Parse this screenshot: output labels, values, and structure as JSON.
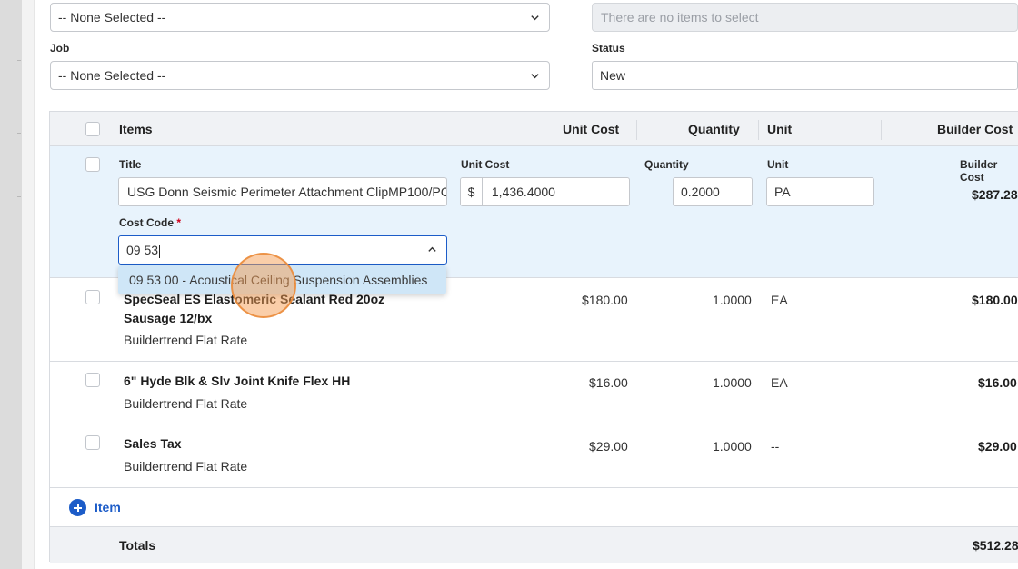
{
  "top_fields": {
    "first_select_value": "-- None Selected --",
    "disabled_field_text": "There are no items to select",
    "job_label": "Job",
    "job_select_value": "-- None Selected --",
    "status_label": "Status",
    "status_value": "New"
  },
  "table": {
    "headers": {
      "items": "Items",
      "unit_cost": "Unit Cost",
      "quantity": "Quantity",
      "unit": "Unit",
      "builder_cost": "Builder Cost"
    },
    "edit_row": {
      "title_label": "Title",
      "title_value": "USG Donn Seismic Perimeter Attachment ClipMP100/PC",
      "unit_cost_label": "Unit Cost",
      "currency_symbol": "$",
      "unit_cost_value": "1,436.4000",
      "quantity_label": "Quantity",
      "quantity_value": "0.2000",
      "unit_label": "Unit",
      "unit_value": "PA",
      "builder_cost_label": "Builder Cost",
      "builder_cost_value": "$287.28",
      "cost_code_label": "Cost Code",
      "required_mark": "*",
      "cost_code_input": "09 53",
      "dropdown_option": "09 53 00 - Acoustical Ceiling Suspension Assemblies"
    },
    "rows": [
      {
        "name": "SpecSeal ES Elastomeric Sealant Red 20oz Sausage 12/bx",
        "subtitle": "Buildertrend Flat Rate",
        "unit_cost": "$180.00",
        "quantity": "1.0000",
        "unit": "EA",
        "builder_cost": "$180.00"
      },
      {
        "name": "6\" Hyde Blk & Slv Joint Knife Flex HH",
        "subtitle": "Buildertrend Flat Rate",
        "unit_cost": "$16.00",
        "quantity": "1.0000",
        "unit": "EA",
        "builder_cost": "$16.00"
      },
      {
        "name": "Sales Tax",
        "subtitle": "Buildertrend Flat Rate",
        "unit_cost": "$29.00",
        "quantity": "1.0000",
        "unit": "--",
        "builder_cost": "$29.00"
      }
    ],
    "add_item_label": "Item",
    "totals_label": "Totals",
    "totals_value": "$512.28"
  },
  "colors": {
    "accent": "#1c5cc8",
    "edit_row_bg": "#e8f3fc",
    "dropdown_highlight": "#cfe6f7",
    "click_indicator": "#f59e54"
  },
  "icons": [
    "chevron-down-icon",
    "chevron-up-icon",
    "plus-circle-icon"
  ]
}
